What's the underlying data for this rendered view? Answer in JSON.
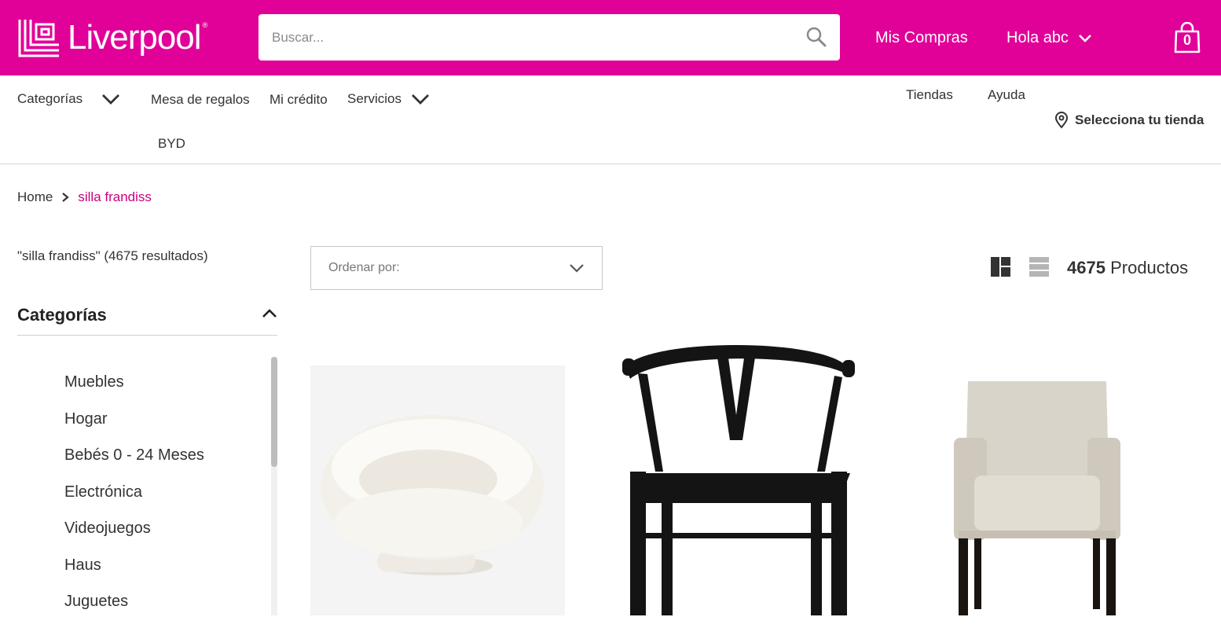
{
  "header": {
    "logo_text": "Liverpool",
    "logo_reg": "®",
    "search_placeholder": "Buscar...",
    "mis_compras": "Mis Compras",
    "greeting": "Hola abc",
    "cart_count": "0",
    "brand_color": "#e10098"
  },
  "nav": {
    "categorias": "Categorías",
    "mesa": "Mesa de regalos",
    "credito": "Mi crédito",
    "servicios": "Servicios",
    "byd": "BYD",
    "tiendas": "Tiendas",
    "ayuda": "Ayuda",
    "store": "Selecciona tu tienda"
  },
  "breadcrumb": {
    "home": "Home",
    "current": "silla frandiss"
  },
  "results_text": "\"silla frandiss\" (4675 resultados)",
  "sidebar": {
    "title": "Categorías",
    "items": [
      "Muebles",
      "Hogar",
      "Bebés 0 - 24 Meses",
      "Electrónica",
      "Videojuegos",
      "Haus",
      "Juguetes"
    ]
  },
  "sort": {
    "placeholder": "Ordenar por:"
  },
  "products_count": {
    "number": "4675",
    "label": "Productos"
  },
  "products": [
    {
      "image": "white-sherpa-round-chair"
    },
    {
      "image": "black-wishbone-chair"
    },
    {
      "image": "beige-upholstered-armchair"
    }
  ]
}
